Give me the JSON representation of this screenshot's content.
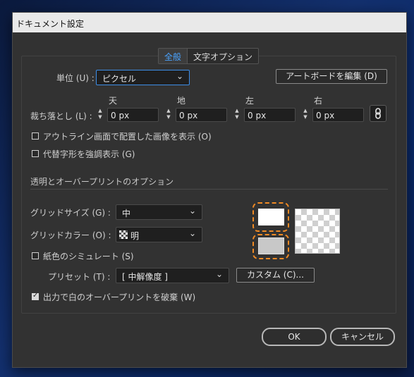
{
  "title": "ドキュメント設定",
  "tabs": [
    {
      "label": "全般",
      "active": true
    },
    {
      "label": "文字オプション",
      "active": false
    }
  ],
  "units": {
    "label": "単位 (U) :",
    "value": "ピクセル"
  },
  "artboard_button": "アートボードを編集 (D)",
  "bleed": {
    "label": "裁ち落とし (L) :",
    "top": {
      "heading": "天",
      "value": "0 px"
    },
    "bottom": {
      "heading": "地",
      "value": "0 px"
    },
    "left": {
      "heading": "左",
      "value": "0 px"
    },
    "right": {
      "heading": "右",
      "value": "0 px"
    }
  },
  "checkboxes": {
    "outline": {
      "label": "アウトライン画面で配置した画像を表示 (O)",
      "checked": false
    },
    "substitute": {
      "label": "代替字形を強調表示 (G)",
      "checked": false
    },
    "paper": {
      "label": "紙色のシミュレート (S)",
      "checked": false
    },
    "discard": {
      "label": "出力で白のオーバープリントを破棄 (W)",
      "checked": true
    }
  },
  "section_title": "透明とオーバープリントのオプション",
  "grid_size": {
    "label": "グリッドサイズ (G) :",
    "value": "中"
  },
  "grid_color": {
    "label": "グリッドカラー (O) :",
    "value": "明"
  },
  "preset": {
    "label": "プリセット (T) :",
    "value": "[ 中解像度 ]"
  },
  "custom_button": "カスタム (C)...",
  "ok_button": "OK",
  "cancel_button": "キャンセル",
  "colors": {
    "highlight": "#f08a24",
    "accent": "#4aa3ff"
  }
}
